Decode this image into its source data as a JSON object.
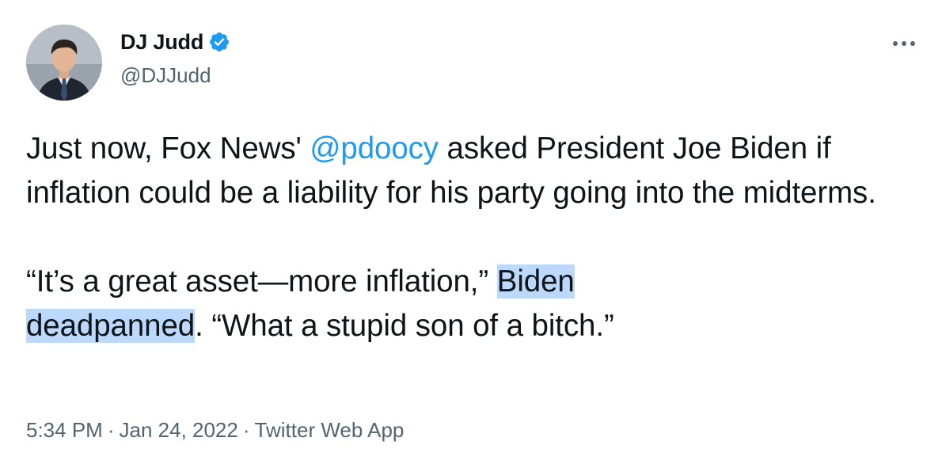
{
  "author": {
    "display_name": "DJ Judd",
    "handle": "@DJJudd",
    "verified": true
  },
  "tweet": {
    "para1_pre": "Just now, Fox News' ",
    "mention": "@pdoocy",
    "para1_post": " asked President Joe Biden if inflation could be a liability for his party going into the midterms.",
    "para2_pre": "“It’s a great asset—more inflation,” ",
    "para2_highlight_a": "Biden ",
    "para2_highlight_b": "deadpanned",
    "para2_post": ". “What a stupid son of a bitch.”"
  },
  "meta": {
    "time": "5:34 PM",
    "separator": "·",
    "date": "Jan 24, 2022",
    "source": "Twitter Web App"
  },
  "icons": {
    "verified": "verified-badge-icon",
    "more": "more-options-icon"
  },
  "colors": {
    "text": "#0f1419",
    "secondary": "#536471",
    "accent": "#1d9bf0",
    "highlight": "#bcd9fb"
  }
}
